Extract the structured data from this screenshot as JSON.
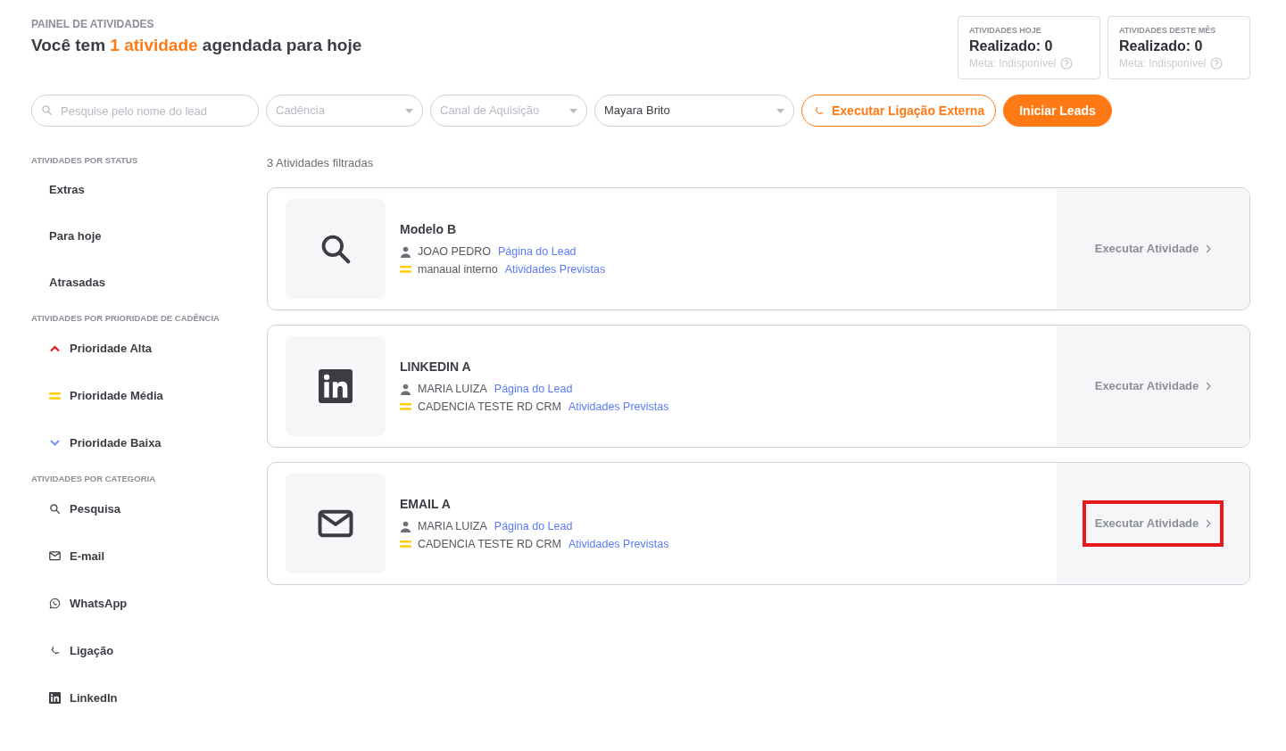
{
  "header": {
    "overline": "PAINEL DE ATIVIDADES",
    "title_parts": [
      {
        "text": "Você tem ",
        "accent": false
      },
      {
        "text": "1 atividade",
        "accent": true
      },
      {
        "text": " agendada para hoje",
        "accent": false
      }
    ]
  },
  "stats": [
    {
      "label": "ATIVIDADES HOJE",
      "value": "Realizado: 0",
      "goal": "Meta: Indisponível"
    },
    {
      "label": "ATIVIDADES DESTE MÊS",
      "value": "Realizado: 0",
      "goal": "Meta: Indisponível"
    }
  ],
  "filters": {
    "search": {
      "placeholder": "Pesquise pelo nome do lead"
    },
    "selects": [
      {
        "placeholder": "Cadência"
      },
      {
        "placeholder": "Canal de Aquisição"
      },
      {
        "value": "Mayara Brito"
      }
    ],
    "buttons": [
      {
        "label": "Executar Ligação Externa",
        "kind": "outline"
      },
      {
        "label": "Iniciar Leads",
        "kind": "solid"
      }
    ]
  },
  "sidebar": {
    "sections": [
      {
        "title": "ATIVIDADES POR STATUS",
        "items": [
          {
            "label": "Extras",
            "kind": "plain"
          },
          {
            "label": "Para hoje",
            "kind": "plain"
          },
          {
            "label": "Atrasadas",
            "kind": "plain"
          }
        ]
      },
      {
        "title": "ATIVIDADES POR PRIORIDADE DE CADÊNCIA",
        "items": [
          {
            "label": "Prioridade Alta",
            "kind": "high"
          },
          {
            "label": "Prioridade Média",
            "kind": "medium"
          },
          {
            "label": "Prioridade Baixa",
            "kind": "low"
          }
        ]
      },
      {
        "title": "ATIVIDADES POR CATEGORIA",
        "items": [
          {
            "label": "Pesquisa",
            "kind": "search"
          },
          {
            "label": "E-mail",
            "kind": "email"
          },
          {
            "label": "WhatsApp",
            "kind": "whatsapp"
          },
          {
            "label": "Ligação",
            "kind": "phone"
          },
          {
            "label": "LinkedIn",
            "kind": "linkedin"
          }
        ]
      }
    ]
  },
  "results_count": "3 Atividades filtradas",
  "activities": [
    {
      "kind": "search",
      "title": "Modelo B",
      "lead": "JOAO PEDRO",
      "lead_link": "Página do Lead",
      "priority": {
        "kind": "medium"
      },
      "cadence": "manaual interno",
      "cadence_link": "Atividades Previstas",
      "action": "Executar Atividade",
      "highlighted": false
    },
    {
      "kind": "linkedin",
      "title": "LINKEDIN A",
      "lead": "MARIA LUIZA",
      "lead_link": "Página do Lead",
      "priority": {
        "kind": "medium"
      },
      "cadence": "CADENCIA TESTE RD CRM",
      "cadence_link": "Atividades Previstas",
      "action": "Executar Atividade",
      "highlighted": false
    },
    {
      "kind": "email",
      "title": "EMAIL A",
      "lead": "MARIA LUIZA",
      "lead_link": "Página do Lead",
      "priority": {
        "kind": "medium"
      },
      "cadence": "CADENCIA TESTE RD CRM",
      "cadence_link": "Atividades Previstas",
      "action": "Executar Atividade",
      "highlighted": true
    }
  ]
}
